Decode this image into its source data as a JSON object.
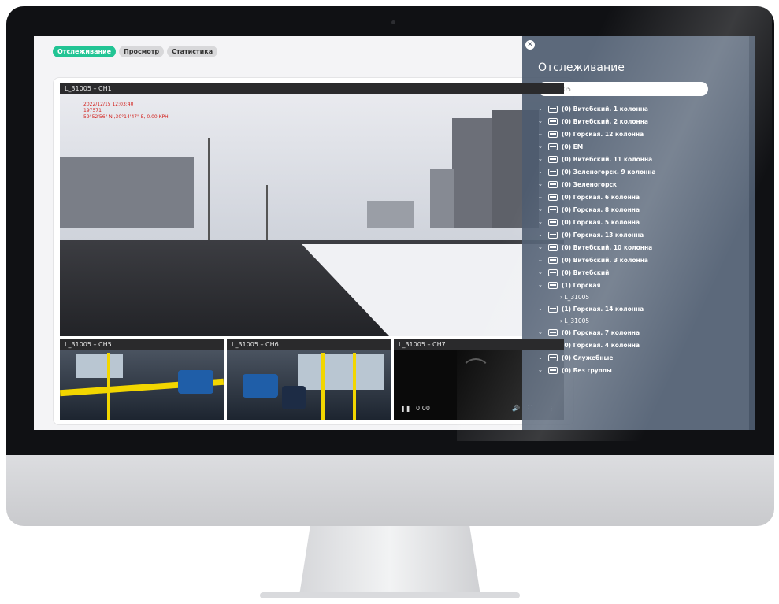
{
  "tabs": [
    {
      "label": "Отслеживание",
      "active": true
    },
    {
      "label": "Просмотр",
      "active": false
    },
    {
      "label": "Статистика",
      "active": false
    }
  ],
  "cameras": {
    "main": {
      "title": "L_31005 – CH1",
      "osd": [
        "2022/12/15 12:03:40",
        "197571",
        "59°52'56\" N ,30°14'47\" E, 0.00 KPH"
      ]
    },
    "ch5": {
      "title": "L_31005 – CH5"
    },
    "ch6": {
      "title": "L_31005 – CH6"
    },
    "ch7": {
      "title": "L_31005 – CH7",
      "time": "0:00"
    }
  },
  "sidebar": {
    "title": "Отслеживание",
    "search_value": "L_31005",
    "groups": [
      "(0) Витебский. 1 колонна",
      "(0) Витебский. 2 колонна",
      "(0) Горская. 12 колонна",
      "(0) ЕМ",
      "(0) Витебский. 11 колонна",
      "(0) Зеленогорск. 9 колонна",
      "(0) Зеленогорск",
      "(0) Горская. 6 колонна",
      "(0) Горская. 8 колонна",
      "(0) Горская. 5 колонна",
      "(0) Горская. 13 колонна",
      "(0) Витебский. 10 колонна",
      "(0) Витебский. 3 колонна",
      "(0) Витебский",
      "(1) Горская",
      "(1) Горская. 14 колонна",
      "(0) Горская. 7 колонна",
      "(0) Горская. 4 колонна",
      "(0) Служебные",
      "(0) Без группы"
    ],
    "child_a": "L_31005",
    "child_b": "L_31005"
  },
  "colors": {
    "accent": "#22c494",
    "sidebar": "#4e5c70",
    "osd": "#d3221e"
  }
}
